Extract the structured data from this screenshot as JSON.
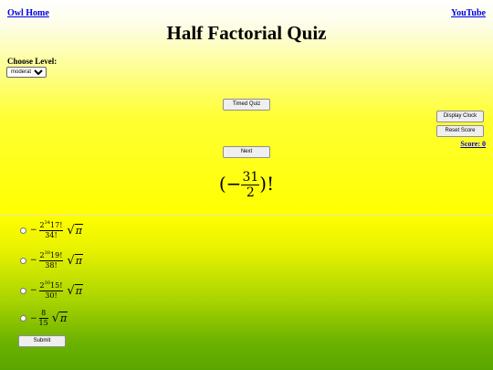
{
  "nav": {
    "home_link": "Owl Home",
    "youtube_link": "YouTube"
  },
  "title": "Half Factorial Quiz",
  "level": {
    "label": "Choose Level:",
    "selected": "moderate"
  },
  "buttons": {
    "timed_quiz": "Timed Quiz",
    "next": "Next",
    "display_clock": "Display Clock",
    "reset_score": "Reset Score",
    "submit": "Submit"
  },
  "score": {
    "label": "Score:",
    "value": "0"
  },
  "question": {
    "sign": "−",
    "numerator": "31",
    "denominator": "2",
    "factorial": "!"
  },
  "answers": [
    {
      "sign": "−",
      "base": "2",
      "exp": "34",
      "num_tail": "17!",
      "denominator": "34!",
      "radical": "π"
    },
    {
      "sign": "−",
      "base": "2",
      "exp": "38",
      "num_tail": "19!",
      "denominator": "38!",
      "radical": "π"
    },
    {
      "sign": "−",
      "base": "2",
      "exp": "30",
      "num_tail": "15!",
      "denominator": "30!",
      "radical": "π"
    },
    {
      "sign": "−",
      "numerator": "8",
      "denominator": "15",
      "radical": "π"
    }
  ],
  "colors": {
    "link": "#0000ee",
    "score": "#0000cc",
    "top_bg": "#ffff00",
    "bottom_bg": "#5aa600"
  },
  "icons": {
    "sqrt": "square-root-symbol",
    "dropdown": "chevron-down-icon"
  }
}
